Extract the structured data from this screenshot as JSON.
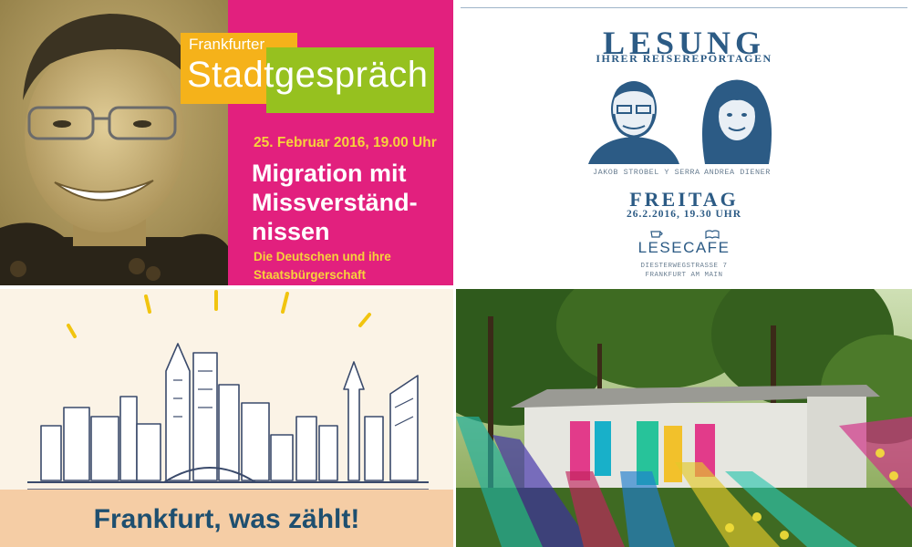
{
  "panel1": {
    "brand_small": "Frankfurter",
    "brand_large": "Stadtgespräch",
    "date": "25. Februar 2016, 19.00 Uhr",
    "heading": "Migration mit\nMissverständ-\nnissen",
    "subtitle": "Die Deutschen und ihre\nStaatsbürgerschaft",
    "colors": {
      "background": "#e2207e",
      "yellow": "#f5b21a",
      "green": "#96c11f",
      "accent_text": "#f7d23b"
    }
  },
  "panel2": {
    "title": "LESUNG",
    "subtitle": "IHRER REISEREPORTAGEN",
    "person1": "JAKOB STROBEL Y SERRA",
    "person2": "ANDREA DIENER",
    "day": "FREITAG",
    "datetime": "26.2.2016, 19.30 UHR",
    "venue": "LESECAFE",
    "street": "DIESTERWEGSTRASSE 7",
    "city": "FRANKFURT AM MAIN",
    "colors": {
      "text": "#2c5b85"
    }
  },
  "panel3": {
    "slogan": "Frankfurt, was zählt!",
    "colors": {
      "background": "#fbf3e6",
      "band": "#f5cda5",
      "text": "#1e4f6f"
    }
  },
  "panel4": {
    "icons": [
      "tree-foliage",
      "garden-house",
      "star-light-beams"
    ]
  }
}
